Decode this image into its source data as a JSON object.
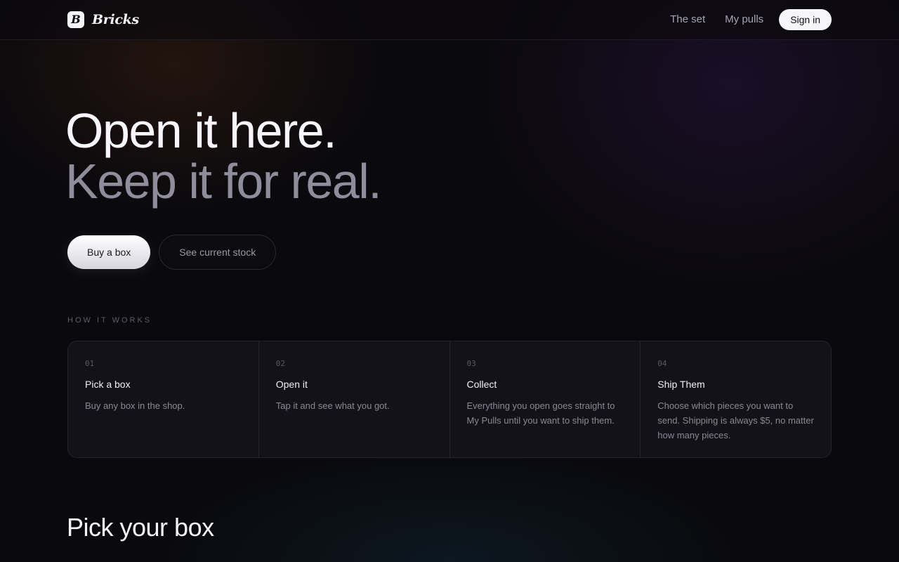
{
  "nav": {
    "brand_mark": "B",
    "brand_name": "Bricks",
    "links": [
      {
        "label": "The set"
      },
      {
        "label": "My pulls"
      }
    ],
    "signin_label": "Sign in"
  },
  "hero": {
    "line1": "Open it here.",
    "line2": "Keep it for real.",
    "primary_cta": "Buy a box",
    "secondary_cta": "See current stock"
  },
  "how_it_works": {
    "label": "HOW IT WORKS",
    "steps": [
      {
        "num": "01",
        "title": "Pick a box",
        "desc": "Buy any box in the shop."
      },
      {
        "num": "02",
        "title": "Open it",
        "desc": "Tap it and see what you got."
      },
      {
        "num": "03",
        "title": "Collect",
        "desc": "Everything you open goes straight to My Pulls until you want to ship them."
      },
      {
        "num": "04",
        "title": "Ship Them",
        "desc": "Choose which pieces you want to send. Shipping is always $5, no matter how many pieces."
      }
    ]
  },
  "pick": {
    "title": "Pick your box"
  },
  "colors": {
    "background": "#0a090d",
    "text_primary": "#f7f6fa",
    "text_muted": "#8f8c9c",
    "border": "#24232b"
  }
}
